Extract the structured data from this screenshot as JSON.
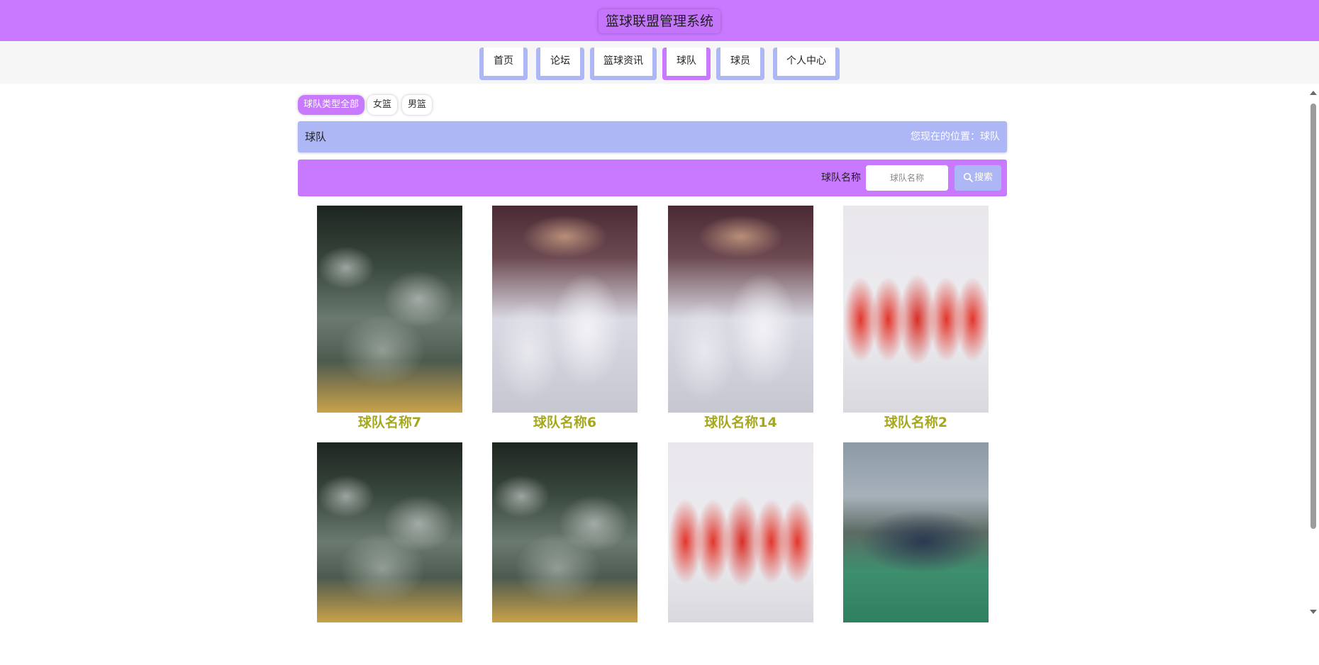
{
  "header": {
    "title": "篮球联盟管理系统"
  },
  "nav": {
    "items": [
      {
        "label": "首页",
        "active": false
      },
      {
        "label": "论坛",
        "active": false
      },
      {
        "label": "篮球资讯",
        "active": false
      },
      {
        "label": "球队",
        "active": true
      },
      {
        "label": "球员",
        "active": false
      },
      {
        "label": "个人中心",
        "active": false
      }
    ]
  },
  "filters": {
    "items": [
      {
        "label": "球队类型全部",
        "active": true
      },
      {
        "label": "女篮",
        "active": false
      },
      {
        "label": "男篮",
        "active": false
      }
    ]
  },
  "section": {
    "title": "球队",
    "location": "您现在的位置：球队"
  },
  "search": {
    "label": "球队名称",
    "placeholder": "球队名称",
    "button_label": "搜索",
    "button_icon": "search-icon"
  },
  "teams": [
    {
      "name": "球队名称7",
      "image": "crowd-celebration-photo"
    },
    {
      "name": "球队名称6",
      "image": "team-huddle-photo"
    },
    {
      "name": "球队名称14",
      "image": "team-huddle-photo"
    },
    {
      "name": "球队名称2",
      "image": "red-jersey-team-photo"
    },
    {
      "name": "",
      "image": "crowd-celebration-photo"
    },
    {
      "name": "",
      "image": "crowd-celebration-photo"
    },
    {
      "name": "",
      "image": "red-jersey-team-photo"
    },
    {
      "name": "",
      "image": "outdoor-court-team-photo"
    }
  ],
  "colors": {
    "header_bg": "#c979ff",
    "nav_border": "#adb7f6",
    "nav_active_border": "#c979ff",
    "team_name": "#a5a81f"
  }
}
